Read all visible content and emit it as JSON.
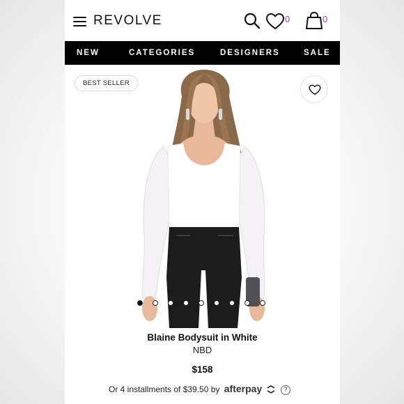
{
  "header": {
    "logo": "REVOLVE",
    "wishlist_count": "0",
    "bag_count": "0",
    "icons": [
      "menu-icon",
      "search-icon",
      "heart-icon",
      "shopping-bag-icon"
    ],
    "accent_color": "#a33fa3"
  },
  "nav": {
    "items": [
      {
        "label": "NEW"
      },
      {
        "label": "CATEGORIES"
      },
      {
        "label": "DESIGNERS"
      },
      {
        "label": "SALE"
      }
    ],
    "background": "#000000"
  },
  "product": {
    "badge": "BEST SELLER",
    "favorite_icon": "heart-outline-icon",
    "image_count": 9,
    "active_image": 1,
    "title": "Blaine Bodysuit in White",
    "brand": "NBD",
    "price": "$158",
    "installments_text": "Or 4 installments of $39.50 by",
    "afterpay_label": "afterpay",
    "help_label": "?"
  }
}
